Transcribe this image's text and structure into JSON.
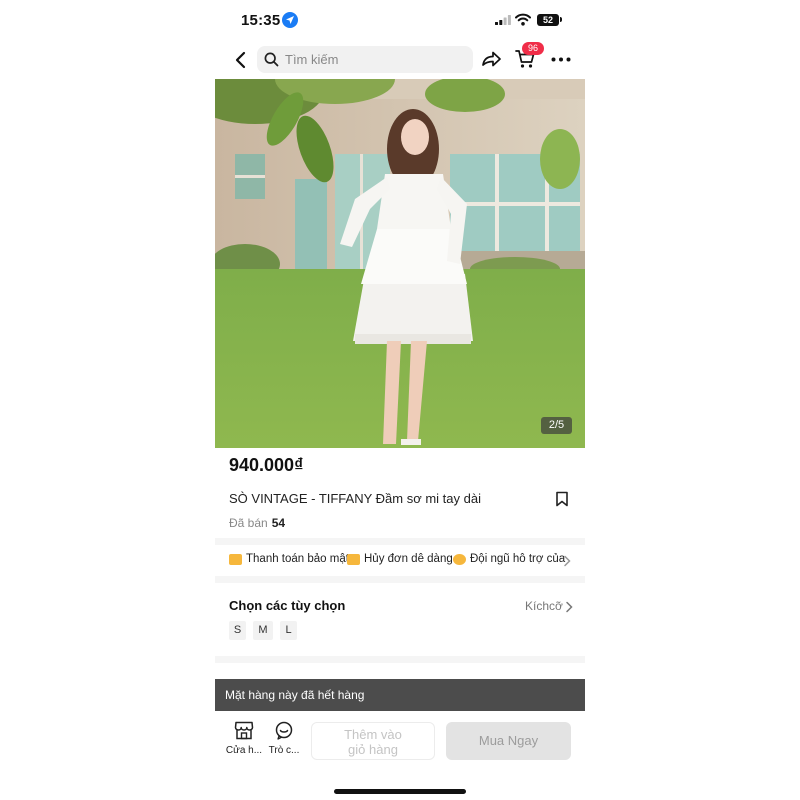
{
  "status_bar": {
    "time": "15:35",
    "battery": "52"
  },
  "nav": {
    "search_placeholder": "Tìm kiếm",
    "cart_count": "96"
  },
  "gallery": {
    "counter": "2/5",
    "current": 2,
    "total": 5
  },
  "product": {
    "price": "940.000₫",
    "title": "SÒ VINTAGE - TIFFANY Đầm sơ mi tay dài",
    "sold_label": "Đã bán",
    "sold_count": "54"
  },
  "services": [
    {
      "label": "Thanh toán bảo mật",
      "icon": "secure-payment-icon"
    },
    {
      "label": "Hủy đơn dễ dàng",
      "icon": "easy-cancel-icon"
    },
    {
      "label": "Đội ngũ hỗ trợ của",
      "icon": "support-team-icon"
    }
  ],
  "options": {
    "title": "Chọn các tùy chọn",
    "link": "Kíchcỡ",
    "sizes": [
      "S",
      "M",
      "L"
    ]
  },
  "toast": {
    "message": "Mặt hàng này đã hết hàng"
  },
  "bottom_bar": {
    "store_label": "Cửa h...",
    "chat_label": "Trò c...",
    "add_to_cart_line1": "Thêm vào",
    "add_to_cart_line2": "giỏ hàng",
    "buy_now": "Mua Ngay"
  },
  "colors": {
    "accent_badge": "#f02d48",
    "service_icon": "#f6b73c",
    "location_blue": "#1a7cf5",
    "toast_bg": "#4c4c4c",
    "disabled_button": "#e3e3e3"
  }
}
